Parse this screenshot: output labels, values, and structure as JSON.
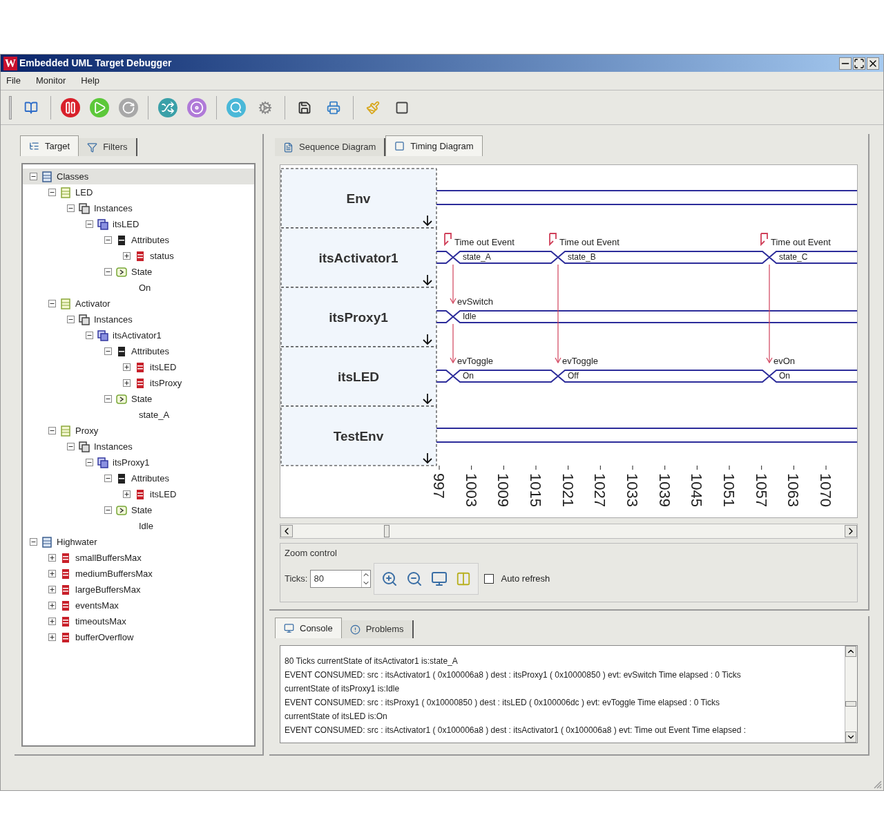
{
  "window": {
    "logo": "W",
    "title": "Embedded UML Target Debugger"
  },
  "menu": [
    "File",
    "Monitor",
    "Help"
  ],
  "left_tabs": [
    {
      "label": "Target",
      "selected": true
    },
    {
      "label": "Filters",
      "selected": false
    }
  ],
  "tree": [
    {
      "label": "Classes",
      "kind": "package",
      "expanded": true,
      "selected": true,
      "children": [
        {
          "label": "LED",
          "kind": "class",
          "expanded": true,
          "selected": false,
          "children": [
            {
              "label": "Instances",
              "kind": "instances",
              "expanded": true,
              "selected": false,
              "children": [
                {
                  "label": "itsLED",
                  "kind": "instance",
                  "expanded": true,
                  "selected": false,
                  "children": [
                    {
                      "label": "Attributes",
                      "kind": "attributes",
                      "expanded": true,
                      "selected": false,
                      "children": [
                        {
                          "label": "status",
                          "kind": "attribute",
                          "expanded": false,
                          "selected": false
                        }
                      ]
                    },
                    {
                      "label": "State",
                      "kind": "state",
                      "expanded": true,
                      "selected": false,
                      "children": [
                        {
                          "label": "On",
                          "kind": "value",
                          "selected": false
                        }
                      ]
                    }
                  ]
                }
              ]
            }
          ]
        },
        {
          "label": "Activator",
          "kind": "class",
          "expanded": true,
          "selected": false,
          "children": [
            {
              "label": "Instances",
              "kind": "instances",
              "expanded": true,
              "selected": false,
              "children": [
                {
                  "label": "itsActivator1",
                  "kind": "instance",
                  "expanded": true,
                  "selected": false,
                  "children": [
                    {
                      "label": "Attributes",
                      "kind": "attributes",
                      "expanded": true,
                      "selected": false,
                      "children": [
                        {
                          "label": "itsLED",
                          "kind": "attribute",
                          "expanded": false,
                          "selected": false
                        },
                        {
                          "label": "itsProxy",
                          "kind": "attribute",
                          "expanded": false,
                          "selected": false
                        }
                      ]
                    },
                    {
                      "label": "State",
                      "kind": "state",
                      "expanded": true,
                      "selected": false,
                      "children": [
                        {
                          "label": "state_A",
                          "kind": "value",
                          "selected": false
                        }
                      ]
                    }
                  ]
                }
              ]
            }
          ]
        },
        {
          "label": "Proxy",
          "kind": "class",
          "expanded": true,
          "selected": false,
          "children": [
            {
              "label": "Instances",
              "kind": "instances",
              "expanded": true,
              "selected": false,
              "children": [
                {
                  "label": "itsProxy1",
                  "kind": "instance",
                  "expanded": true,
                  "selected": false,
                  "children": [
                    {
                      "label": "Attributes",
                      "kind": "attributes",
                      "expanded": true,
                      "selected": false,
                      "children": [
                        {
                          "label": "itsLED",
                          "kind": "attribute",
                          "expanded": false,
                          "selected": false
                        }
                      ]
                    },
                    {
                      "label": "State",
                      "kind": "state",
                      "expanded": true,
                      "selected": false,
                      "children": [
                        {
                          "label": "Idle",
                          "kind": "value",
                          "selected": false
                        }
                      ]
                    }
                  ]
                }
              ]
            }
          ]
        }
      ]
    },
    {
      "label": "Highwater",
      "kind": "package",
      "expanded": true,
      "selected": false,
      "children": [
        {
          "label": "smallBuffersMax",
          "kind": "attribute",
          "expanded": false,
          "selected": false
        },
        {
          "label": "mediumBuffersMax",
          "kind": "attribute",
          "expanded": false,
          "selected": false
        },
        {
          "label": "largeBuffersMax",
          "kind": "attribute",
          "expanded": false,
          "selected": false
        },
        {
          "label": "eventsMax",
          "kind": "attribute",
          "expanded": false,
          "selected": false
        },
        {
          "label": "timeoutsMax",
          "kind": "attribute",
          "expanded": false,
          "selected": false
        },
        {
          "label": "bufferOverflow",
          "kind": "attribute",
          "expanded": false,
          "selected": false
        }
      ]
    }
  ],
  "diagram_tabs": [
    {
      "label": "Sequence Diagram",
      "selected": false
    },
    {
      "label": "Timing Diagram",
      "selected": true
    }
  ],
  "timing": {
    "lanes": [
      {
        "name": "Env",
        "kind": "line"
      },
      {
        "name": "itsActivator1",
        "kind": "bus",
        "segments": [
          {
            "state": "state_A",
            "event": "Time out Event",
            "kind": "timeout"
          },
          {
            "state": "state_B",
            "event": "Time out Event",
            "kind": "timeout"
          },
          {
            "state": "state_C",
            "event": "Time out Event",
            "kind": "timeout"
          }
        ]
      },
      {
        "name": "itsProxy1",
        "kind": "bus",
        "segments": [
          {
            "state": "Idle",
            "event": "evSwitch",
            "kind": "message"
          }
        ]
      },
      {
        "name": "itsLED",
        "kind": "bus",
        "segments": [
          {
            "state": "On",
            "event": "evToggle",
            "kind": "message"
          },
          {
            "state": "Off",
            "event": "evToggle",
            "kind": "message"
          },
          {
            "state": "On",
            "event": "evOn",
            "kind": "message"
          }
        ]
      },
      {
        "name": "TestEnv",
        "kind": "line"
      }
    ],
    "ticks": [
      "997",
      "1003",
      "1009",
      "1015",
      "1021",
      "1027",
      "1033",
      "1039",
      "1045",
      "1051",
      "1057",
      "1063",
      "1070"
    ]
  },
  "zoom_control": {
    "title": "Zoom control",
    "ticks_label": "Ticks:",
    "ticks_value": "80",
    "auto_refresh": {
      "label": "Auto refresh",
      "checked": false
    }
  },
  "bottom_tabs": [
    {
      "label": "Console",
      "selected": true
    },
    {
      "label": "Problems",
      "selected": false
    }
  ],
  "console": {
    "lines": [
      "80 Ticks currentState of itsActivator1 is:state_A",
      "EVENT CONSUMED: src : itsActivator1 ( 0x100006a8 ) dest : itsProxy1 ( 0x10000850 ) evt: evSwitch Time elapsed : 0 Ticks",
      "currentState of itsProxy1 is:Idle",
      "EVENT CONSUMED: src : itsProxy1 ( 0x10000850 ) dest : itsLED ( 0x100006dc ) evt: evToggle Time elapsed : 0 Ticks",
      "currentState of itsLED is:On",
      "EVENT CONSUMED: src : itsActivator1 ( 0x100006a8 ) dest : itsActivator1 ( 0x100006a8 ) evt: Time out Event Time elapsed :"
    ]
  }
}
